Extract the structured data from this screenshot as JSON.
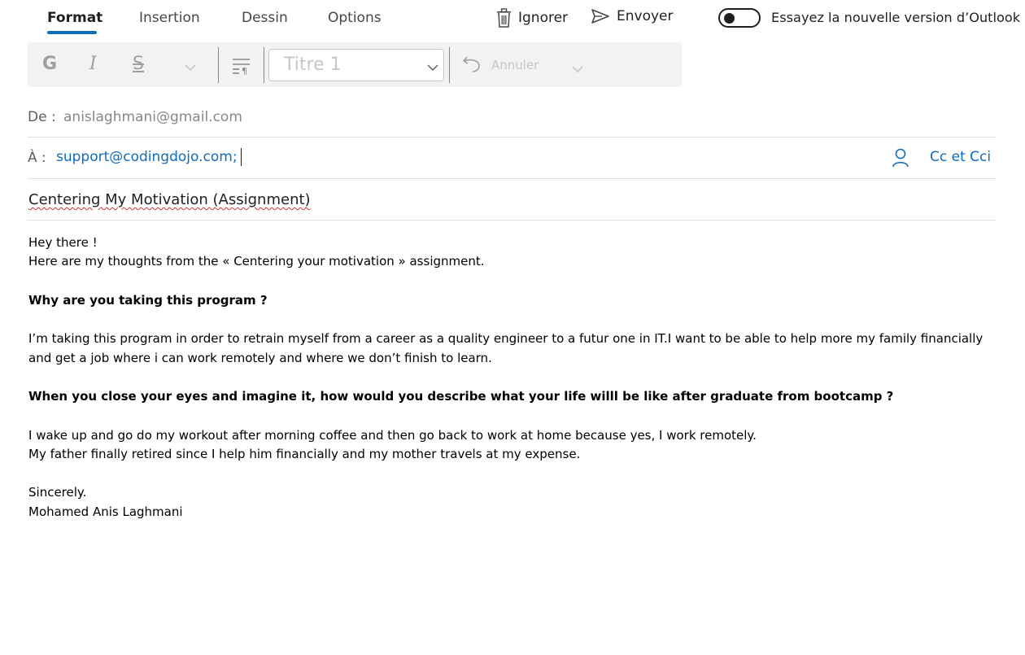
{
  "tabs": [
    "Format",
    "Insertion",
    "Dessin",
    "Options"
  ],
  "actions": {
    "discard": "Ignorer",
    "send": "Envoyer"
  },
  "toggle_label": "Essayez la nouvelle version d’Outlook",
  "toolbar": {
    "bold": "G",
    "italic": "I",
    "strikethrough": "S",
    "style_value": "Titre 1",
    "undo_label": "Annuler"
  },
  "from": {
    "label": "De :",
    "value": "anislaghmani@gmail.com"
  },
  "to": {
    "label": "À :",
    "recipient": "support@codingdojo.com;"
  },
  "cc_label": "Cc et Cci",
  "subject": "Centering My Motivation (Assignment)",
  "body": {
    "line1": "Hey there !",
    "line2": " Here are my thoughts from the « Centering your motivation » assignment.",
    "q1": "Why are you taking this program ?",
    "a1_1": "I’m taking this program in order to retrain myself from a career as a quality engineer to a futur one in IT.I want  to be able to help more my family financially",
    "a1_2": "and get a job where i can work remotely and where we don’t finish to learn.",
    "q2": "When you close your eyes and imagine it, how would you describe what your life willl be like after graduate from bootcamp ?",
    "a2_1": "I wake up and go do my workout after morning coffee and then go back to work at home because yes, I work remotely.",
    "a2_2": "My father finally retired since I help him financially and my mother travels at my expense.",
    "closing": "Sincerely.",
    "signature": " Mohamed Anis Laghmani"
  },
  "colors": {
    "accent": "#0f6cbd",
    "spellcheck": "#d13438"
  },
  "icons": [
    "trash-icon",
    "send-icon",
    "toggle-switch",
    "style-dropdown-chevron-icon",
    "undo-icon",
    "paragraph-icon",
    "person-icon"
  ]
}
